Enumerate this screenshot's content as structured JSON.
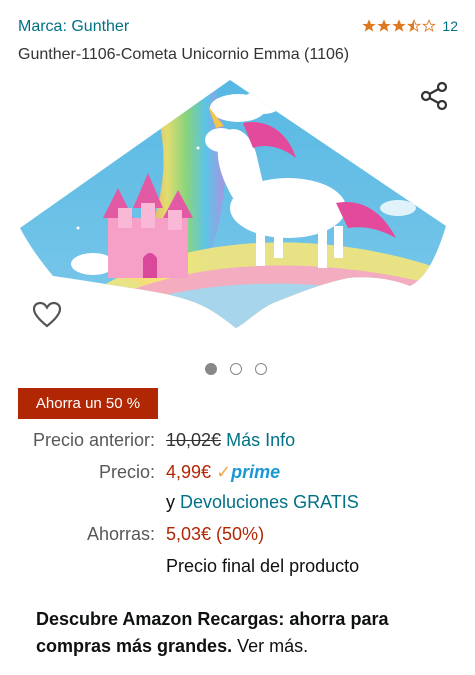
{
  "header": {
    "brand": "Marca: Gunther",
    "rating_count": "12",
    "rating_value": 3.5,
    "title": "Gunther-1106-Cometa Unicornio Emma (1106)"
  },
  "carousel": {
    "image_count": 3,
    "active_index": 0
  },
  "icons": {
    "share": "share-icon",
    "wishlist": "heart-icon"
  },
  "pricing": {
    "badge": "Ahorra un 50 %",
    "previous_label": "Precio anterior:",
    "previous_value": "10,02€",
    "more_info": "Más Info",
    "price_label": "Precio:",
    "price_value": "4,99€",
    "prime_check": "✓",
    "prime_word": "prime",
    "returns_prefix": "y",
    "returns_link": "Devoluciones GRATIS",
    "savings_label": "Ahorras:",
    "savings_value": "5,03€ (50%)",
    "final_price_note": "Precio final del producto"
  },
  "promo": {
    "bold": "Descubre Amazon Recargas: ahorra para compras más grandes.",
    "link": "Ver más."
  },
  "colors": {
    "link": "#007185",
    "price_red": "#b12704",
    "star": "#de7921",
    "prime_blue": "#1a98d5"
  }
}
